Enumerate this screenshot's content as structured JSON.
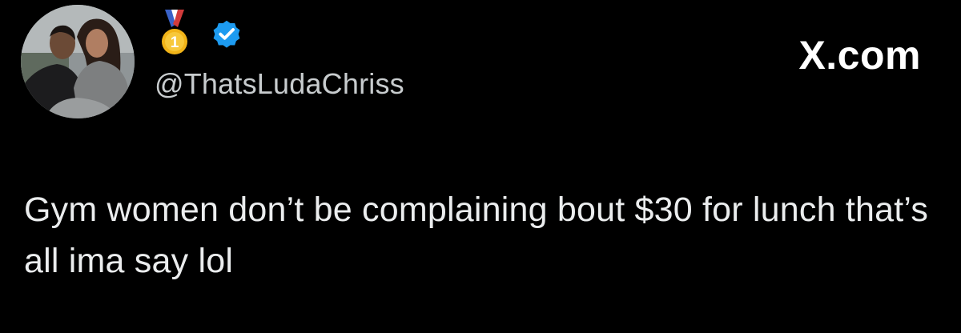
{
  "tweet": {
    "handle": "@ThatsLudaChriss",
    "text": "Gym women don’t be complaining bout $30 for lunch that’s all ima say lol",
    "badges": [
      {
        "icon": "gold-medal-icon",
        "label": "1"
      },
      {
        "icon": "verified-badge-icon"
      }
    ]
  },
  "branding": {
    "site": "X.com"
  },
  "colors": {
    "background": "#000000",
    "text": "#e7e9ea",
    "handle": "#c8ccce",
    "verified": "#1d9bf0",
    "medal": "#f2b418"
  }
}
